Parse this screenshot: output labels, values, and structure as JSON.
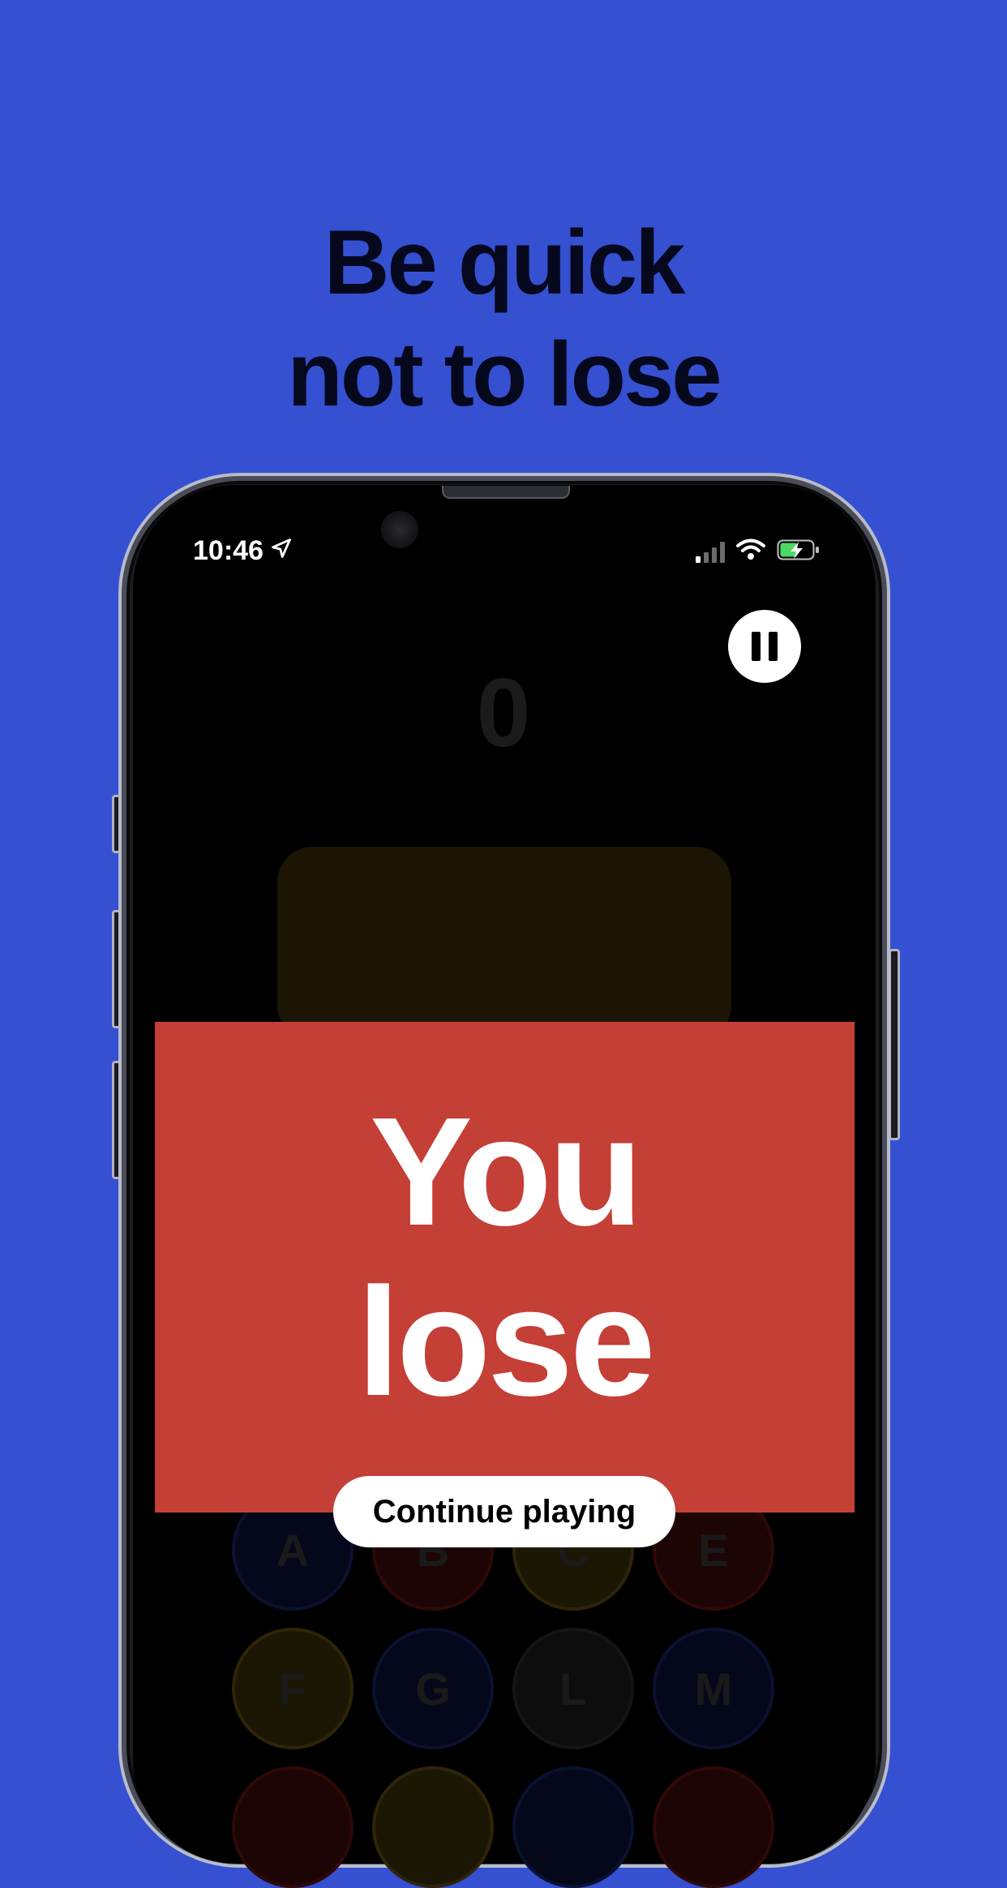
{
  "headline": {
    "line1": "Be quick",
    "line2": "not to lose"
  },
  "status_bar": {
    "time": "10:46",
    "location_icon": "location-arrow-icon",
    "signal_icon": "cellular-signal-icon",
    "wifi_icon": "wifi-icon",
    "battery_icon": "battery-charging-icon"
  },
  "game": {
    "score": "0",
    "pause_icon": "pause-icon",
    "result_line1": "You",
    "result_line2": "lose",
    "continue_label": "Continue playing",
    "keys_row1": [
      "A",
      "B",
      "C",
      "E"
    ],
    "keys_row2": [
      "F",
      "G",
      "L",
      "M"
    ]
  },
  "colors": {
    "background": "#3550d0",
    "lose_panel": "#c43f36",
    "headline": "#06081e"
  }
}
